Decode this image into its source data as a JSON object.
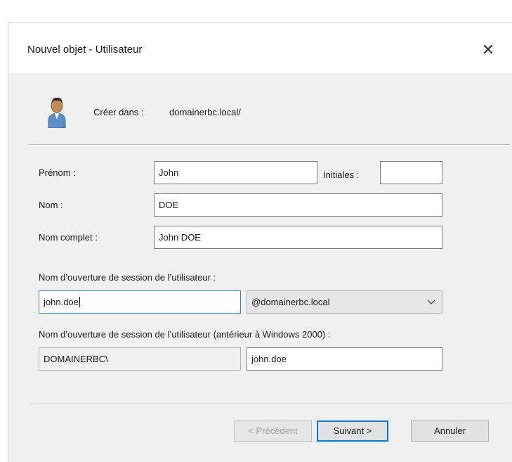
{
  "dialog": {
    "title": "Nouvel objet - Utilisateur",
    "close_glyph": "✕",
    "icons": {
      "header": "user-icon",
      "close": "close-icon",
      "dropdown": "chevron-down-icon"
    }
  },
  "location": {
    "label": "Créer dans :",
    "value": "domainerbc.local/"
  },
  "form": {
    "first_name": {
      "label": "Prénom :",
      "value": "John"
    },
    "initials": {
      "label": "Initiales :",
      "value": ""
    },
    "last_name": {
      "label": "Nom :",
      "value": "DOE"
    },
    "full_name": {
      "label": "Nom complet :",
      "value": "John DOE"
    },
    "logon": {
      "label": "Nom d’ouverture de session de l’utilisateur :",
      "value": "john.doe",
      "domain_selected": "@domainerbc.local"
    },
    "logon_pre2000": {
      "label": "Nom d’ouverture de session de l’utilisateur (antérieur à Windows 2000) :",
      "domain_prefix": "DOMAINERBC\\",
      "value": "john.doe"
    }
  },
  "buttons": {
    "previous": "< Précédent",
    "next": "Suivant >",
    "cancel": "Annuler"
  },
  "colors": {
    "focus_border": "#3b82d6",
    "default_button_border": "#0078d7",
    "icon_head": "#c08a5a",
    "icon_body": "#5b8fc7"
  }
}
